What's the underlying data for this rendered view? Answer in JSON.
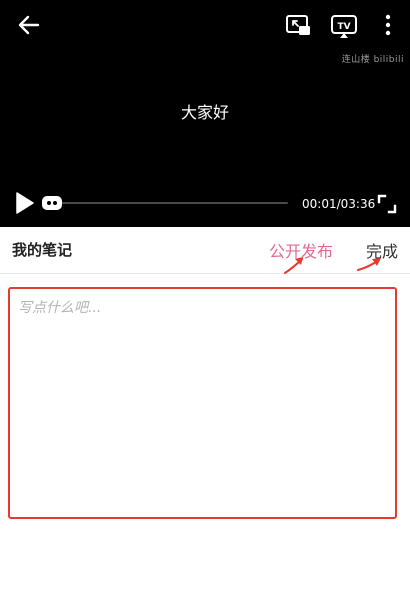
{
  "player": {
    "subtitle": "大家好",
    "watermark": "连山楼 bilibili",
    "current_time": "00:01",
    "duration": "03:36",
    "time_display": "00:01/03:36",
    "progress_fraction": 0.005,
    "icons": {
      "back": "back-arrow-icon",
      "pip": "picture-in-picture-icon",
      "cast": "tv-cast-icon",
      "more": "more-vertical-icon",
      "play": "play-icon",
      "fullscreen": "fullscreen-icon"
    }
  },
  "notes": {
    "title": "我的笔记",
    "publish_label": "公开发布",
    "done_label": "完成",
    "placeholder": "写点什么吧..."
  },
  "colors": {
    "publish": "#e06b92",
    "annotation": "#e53a2f"
  }
}
